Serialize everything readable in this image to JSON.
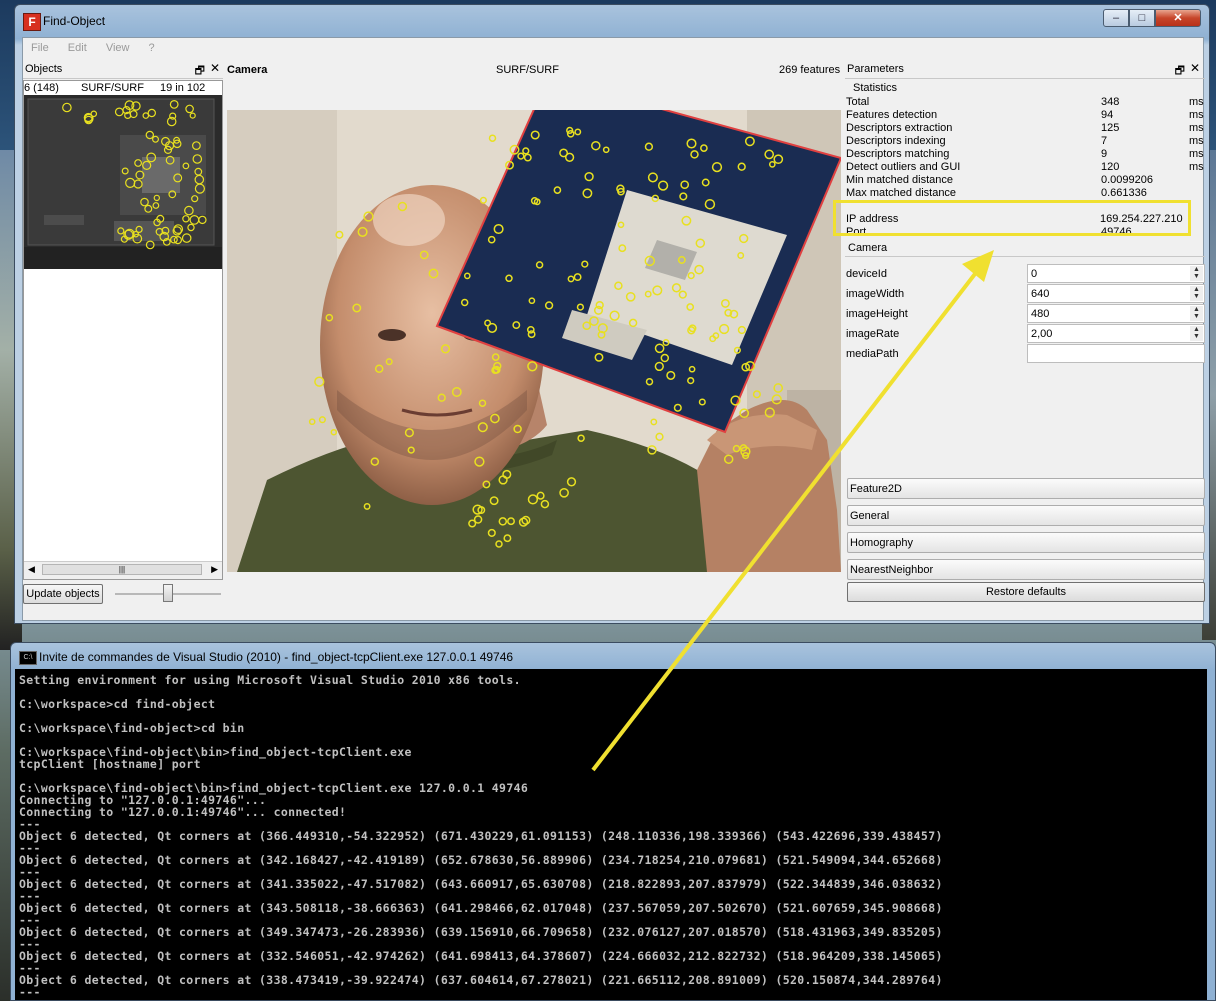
{
  "fo_window": {
    "title": "Find-Object",
    "icon": "F",
    "controls": {
      "minimize": "–",
      "maximize": "□",
      "close": "✕"
    },
    "menu": [
      "File",
      "Edit",
      "View",
      "?"
    ]
  },
  "objects_dock": {
    "title": "Objects",
    "float_icon": "🗗",
    "close_icon": "✕",
    "row": {
      "id": "6 (148)",
      "detector": "SURF/SURF",
      "inliers": "19 in 102 out"
    },
    "scroll_grip": "|||",
    "scroll_left": "◀",
    "scroll_right": "▶",
    "update_button": "Update objects"
  },
  "camera": {
    "title": "Camera",
    "detector": "SURF/SURF",
    "features": "269 features"
  },
  "parameters": {
    "title": "Parameters",
    "statistics_title": "Statistics",
    "stats": [
      {
        "label": "Total",
        "value": "348",
        "unit": "ms"
      },
      {
        "label": "Features detection",
        "value": "94",
        "unit": "ms"
      },
      {
        "label": "Descriptors extraction",
        "value": "125",
        "unit": "ms"
      },
      {
        "label": "Descriptors indexing",
        "value": "7",
        "unit": "ms"
      },
      {
        "label": "Descriptors matching",
        "value": "9",
        "unit": "ms"
      },
      {
        "label": "Detect outliers and GUI",
        "value": "120",
        "unit": "ms"
      },
      {
        "label": "Min matched distance",
        "value": "0.0099206",
        "unit": ""
      },
      {
        "label": "Max matched distance",
        "value": "0.661336",
        "unit": ""
      }
    ],
    "network": [
      {
        "label": "IP address",
        "value": "169.254.227.210"
      },
      {
        "label": "Port",
        "value": "49746"
      }
    ],
    "camera_section": "Camera",
    "camera_params": [
      {
        "label": "deviceId",
        "value": "0"
      },
      {
        "label": "imageWidth",
        "value": "640"
      },
      {
        "label": "imageHeight",
        "value": "480"
      },
      {
        "label": "imageRate",
        "value": "2,00"
      },
      {
        "label": "mediaPath",
        "value": ""
      }
    ],
    "toolboxes": [
      "Feature2D",
      "General",
      "Homography",
      "NearestNeighbor"
    ],
    "restore_button": "Restore defaults"
  },
  "console": {
    "icon": "C:\\",
    "title": "Invite de commandes de Visual Studio (2010) - find_object-tcpClient.exe  127.0.0.1 49746",
    "lines": [
      "Setting environment for using Microsoft Visual Studio 2010 x86 tools.",
      "",
      "C:\\workspace>cd find-object",
      "",
      "C:\\workspace\\find-object>cd bin",
      "",
      "C:\\workspace\\find-object\\bin>find_object-tcpClient.exe",
      "tcpClient [hostname] port",
      "",
      "C:\\workspace\\find-object\\bin>find_object-tcpClient.exe 127.0.0.1 49746",
      "Connecting to \"127.0.0.1:49746\"...",
      "Connecting to \"127.0.0.1:49746\"... connected!",
      "---",
      "Object 6 detected, Qt corners at (366.449310,-54.322952) (671.430229,61.091153) (248.110336,198.339366) (543.422696,339.438457)",
      "---",
      "Object 6 detected, Qt corners at (342.168427,-42.419189) (652.678630,56.889906) (234.718254,210.079681) (521.549094,344.652668)",
      "---",
      "Object 6 detected, Qt corners at (341.335022,-47.517082) (643.660917,65.630708) (218.822893,207.837979) (522.344839,346.038632)",
      "---",
      "Object 6 detected, Qt corners at (343.508118,-38.666363) (641.298466,62.017048) (237.567059,207.502670) (521.607659,345.908668)",
      "---",
      "Object 6 detected, Qt corners at (349.347473,-26.283936) (639.156910,66.709658) (232.076127,207.018570) (518.431963,349.835205)",
      "---",
      "Object 6 detected, Qt corners at (332.546051,-42.974262) (641.698413,64.378607) (224.666032,212.822732) (518.964209,338.145065)",
      "---",
      "Object 6 detected, Qt corners at (338.473419,-39.922474) (637.604614,67.278021) (221.665112,208.891009) (520.150874,344.289764)",
      "---"
    ]
  },
  "colors": {
    "highlight": "#f0e030",
    "feature_points": "#e8e020",
    "object_box": "#e04040",
    "console_bg": "#000000",
    "console_text": "#c0c0c0"
  }
}
